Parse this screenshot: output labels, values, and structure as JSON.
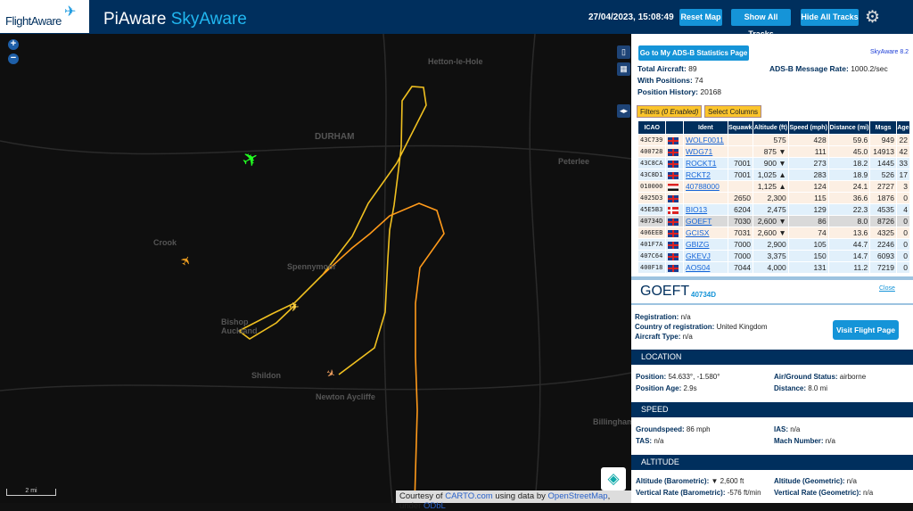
{
  "header": {
    "logo": "FlightAware",
    "title_a": "PiAware",
    "title_b": "SkyAware",
    "datetime": "27/04/2023, 15:08:49",
    "reset_map": "Reset Map",
    "show_tracks": "Show All Tracks",
    "hide_tracks": "Hide All Tracks"
  },
  "map": {
    "labels": [
      "Hetton-le-Hole",
      "DURHAM",
      "Peterlee",
      "Crook",
      "Spennymoor",
      "Bishop Auckland",
      "Shildon",
      "Newton Aycliffe",
      "Billingham"
    ],
    "scale": "2 mi",
    "attribution": {
      "prefix": "Courtesy of",
      "carto": "CARTO.com",
      "mid": "using data by",
      "osm": "OpenStreetMap",
      "under": ", under",
      "odbl": "ODbL"
    }
  },
  "panel": {
    "stats_button": "Go to My ADS-B Statistics Page",
    "version": "SkyAware 8.2",
    "total_label": "Total Aircraft:",
    "total": "89",
    "pos_label": "With Positions:",
    "pos": "74",
    "hist_label": "Position History:",
    "hist": "20168",
    "rate_label": "ADS-B Message Rate:",
    "rate": "1000.2/sec",
    "filters_label": "Filters",
    "filters_state": "(0 Enabled)",
    "select_columns": "Select Columns",
    "columns": [
      "ICAO",
      "",
      "Ident",
      "Squawk",
      "Altitude (ft)",
      "Speed (mph)",
      "Distance (mi)",
      "Msgs",
      "Age"
    ],
    "rows": [
      {
        "icao": "43C739",
        "flag": "uk",
        "ident": "WOLF0011",
        "squawk": "",
        "alt": "575",
        "speed": "428",
        "dist": "59.6",
        "msgs": "949",
        "age": "22",
        "c": "a"
      },
      {
        "icao": "400728",
        "flag": "uk",
        "ident": "WDG71",
        "squawk": "",
        "alt": "875 ▼",
        "speed": "111",
        "dist": "45.0",
        "msgs": "14913",
        "age": "42",
        "c": "a"
      },
      {
        "icao": "43C8CA",
        "flag": "uk",
        "ident": "ROCKT1",
        "squawk": "7001",
        "alt": "900 ▼",
        "speed": "273",
        "dist": "18.2",
        "msgs": "1445",
        "age": "33",
        "c": "b"
      },
      {
        "icao": "43C8D1",
        "flag": "uk",
        "ident": "RCKT2",
        "squawk": "7001",
        "alt": "1,025 ▲",
        "speed": "283",
        "dist": "18.9",
        "msgs": "526",
        "age": "17",
        "c": "b"
      },
      {
        "icao": "010000",
        "flag": "eg",
        "ident": "40788000",
        "squawk": "",
        "alt": "1,125 ▲",
        "speed": "124",
        "dist": "24.1",
        "msgs": "2727",
        "age": "3",
        "c": "a"
      },
      {
        "icao": "4025D3",
        "flag": "uk",
        "ident": "",
        "squawk": "2650",
        "alt": "2,300",
        "speed": "115",
        "dist": "36.6",
        "msgs": "1876",
        "age": "0",
        "c": "a"
      },
      {
        "icao": "45E5B3",
        "flag": "dk",
        "ident": "BIO13",
        "squawk": "6204",
        "alt": "2,475",
        "speed": "129",
        "dist": "22.3",
        "msgs": "4535",
        "age": "4",
        "c": "b"
      },
      {
        "icao": "40734D",
        "flag": "uk",
        "ident": "GOEFT",
        "squawk": "7030",
        "alt": "2,600 ▼",
        "speed": "86",
        "dist": "8.0",
        "msgs": "8726",
        "age": "0",
        "c": "sel"
      },
      {
        "icao": "406EEB",
        "flag": "uk",
        "ident": "GCISX",
        "squawk": "7031",
        "alt": "2,600 ▼",
        "speed": "74",
        "dist": "13.6",
        "msgs": "4325",
        "age": "0",
        "c": "a"
      },
      {
        "icao": "401F7A",
        "flag": "uk",
        "ident": "GBIZG",
        "squawk": "7000",
        "alt": "2,900",
        "speed": "105",
        "dist": "44.7",
        "msgs": "2246",
        "age": "0",
        "c": "b"
      },
      {
        "icao": "407C64",
        "flag": "uk",
        "ident": "GKEVJ",
        "squawk": "7000",
        "alt": "3,375",
        "speed": "150",
        "dist": "14.7",
        "msgs": "6093",
        "age": "0",
        "c": "b"
      },
      {
        "icao": "400F18",
        "flag": "uk",
        "ident": "AOS04",
        "squawk": "7044",
        "alt": "4,000",
        "speed": "131",
        "dist": "11.2",
        "msgs": "7219",
        "age": "0",
        "c": "b"
      }
    ]
  },
  "selected": {
    "ident": "GOEFT",
    "icao": "40734D",
    "close": "Close",
    "visit": "Visit Flight Page",
    "fields": [
      [
        "Registration:",
        "n/a"
      ],
      [
        "Country of registration:",
        "United Kingdom"
      ],
      [
        "Aircraft Type:",
        "n/a"
      ]
    ],
    "location": {
      "title": "LOCATION",
      "pos_l": "Position:",
      "pos": "54.633°, -1.580°",
      "age_l": "Position Age:",
      "age": "2.9s",
      "ag_l": "Air/Ground Status:",
      "ag": "airborne",
      "dist_l": "Distance:",
      "dist": "8.0 mi"
    },
    "speed": {
      "title": "SPEED",
      "gs_l": "Groundspeed:",
      "gs": "86 mph",
      "tas_l": "TAS:",
      "tas": "n/a",
      "ias_l": "IAS:",
      "ias": "n/a",
      "mach_l": "Mach Number:",
      "mach": "n/a"
    },
    "altitude": {
      "title": "ALTITUDE",
      "baro_l": "Altitude (Barometric):",
      "baro": "▼ 2,600 ft",
      "geom_l": "Altitude (Geometric):",
      "geom": "n/a",
      "vr_l": "Vertical Rate (Barometric):",
      "vr": "-576 ft/min",
      "vrg_l": "Vertical Rate (Geometric):",
      "vrg": "n/a"
    }
  },
  "colors": {
    "header": "#002f5d",
    "accent": "#1594d8",
    "filter": "#fbc42b"
  }
}
